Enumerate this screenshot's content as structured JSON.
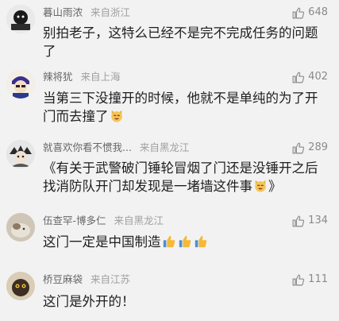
{
  "comments": [
    {
      "username": "暮山雨浓",
      "source": "来自浙江",
      "likes": "648",
      "text": "别拍老子，这特么已经不是完不完成任务的问题了"
    },
    {
      "username": "辣将犹",
      "source": "来自上海",
      "likes": "402",
      "text": "当第三下没撞开的时候，他就不是单纯的为了开门而去撞了"
    },
    {
      "username": "就喜欢你看不惯我...",
      "source": "来自黑龙江",
      "likes": "289",
      "text": "《有关于武警破门锤轮冒烟了门还是没锤开之后找消防队开门却发现是一堵墙这件事",
      "text_end": "》"
    },
    {
      "username": "伍查罕-博多仁",
      "source": "来自黑龙江",
      "likes": "134",
      "text": "这门一定是中国制造"
    },
    {
      "username": "桥豆麻袋",
      "source": "来自江苏",
      "likes": "111",
      "text": "这门是外开的！"
    }
  ],
  "icons": {
    "like": "thumbs-up-outline-icon",
    "emoji_cat": "cat-laugh-emoji",
    "emoji_thumb": "thumbs-up-emoji"
  },
  "colors": {
    "background": "#f2f2f2",
    "username": "#666666",
    "source": "#a0a0a0",
    "text": "#1e1e1e",
    "like_icon": "#8a8a8a"
  }
}
